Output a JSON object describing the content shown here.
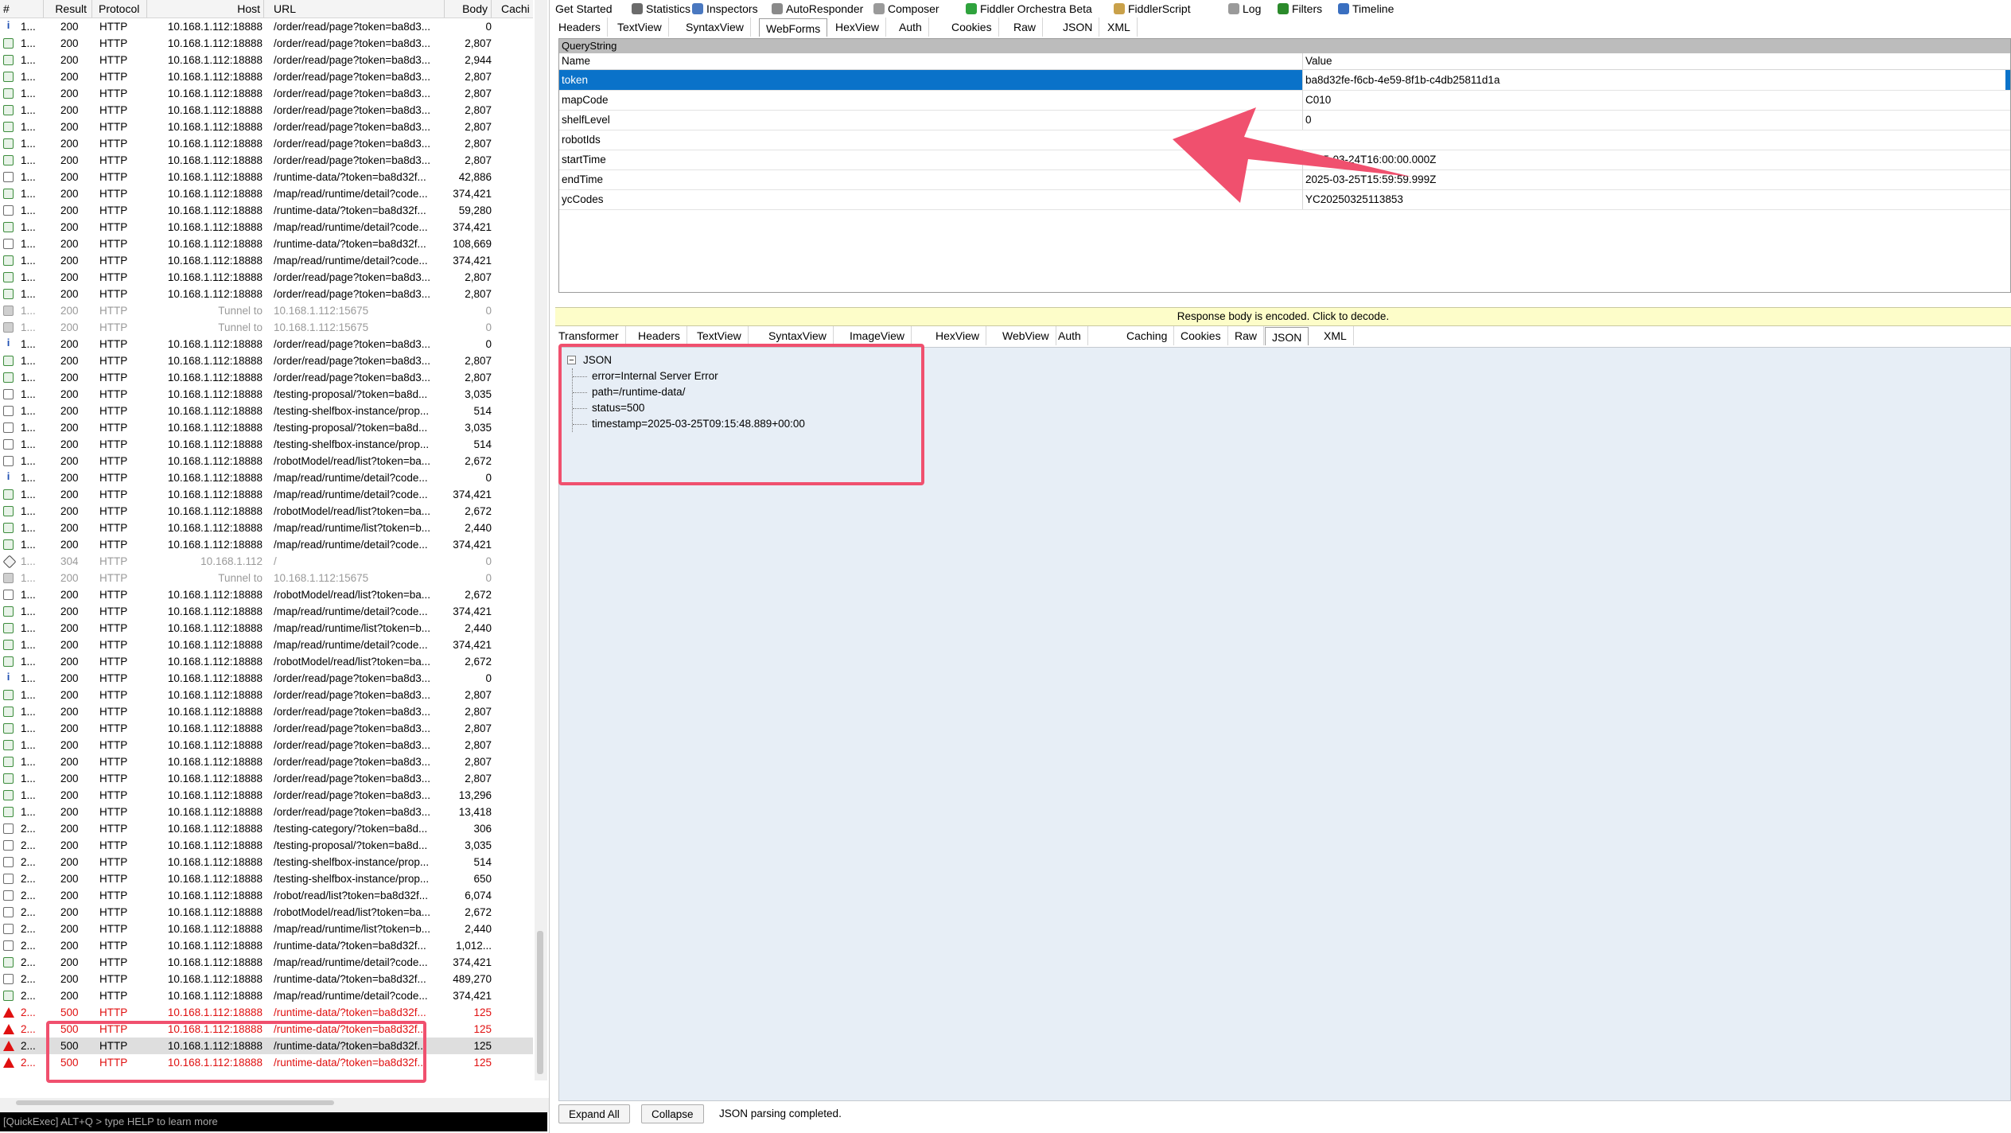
{
  "sessions": {
    "columns": {
      "num": "#",
      "result": "Result",
      "protocol": "Protocol",
      "host": "Host",
      "url": "URL",
      "body": "Body",
      "caching": "Cachi"
    },
    "rows": [
      {
        "icon": "info-icon",
        "num": "1...",
        "result": "200",
        "protocol": "HTTP",
        "host": "10.168.1.112:18888",
        "url": "/order/read/page?token=ba8d3...",
        "body": "0",
        "kind": "normal"
      },
      {
        "icon": "document-icon",
        "num": "1...",
        "result": "200",
        "protocol": "HTTP",
        "host": "10.168.1.112:18888",
        "url": "/order/read/page?token=ba8d3...",
        "body": "2,807",
        "kind": "normal"
      },
      {
        "icon": "document-icon",
        "num": "1...",
        "result": "200",
        "protocol": "HTTP",
        "host": "10.168.1.112:18888",
        "url": "/order/read/page?token=ba8d3...",
        "body": "2,944",
        "kind": "normal"
      },
      {
        "icon": "document-icon",
        "num": "1...",
        "result": "200",
        "protocol": "HTTP",
        "host": "10.168.1.112:18888",
        "url": "/order/read/page?token=ba8d3...",
        "body": "2,807",
        "kind": "normal"
      },
      {
        "icon": "document-icon",
        "num": "1...",
        "result": "200",
        "protocol": "HTTP",
        "host": "10.168.1.112:18888",
        "url": "/order/read/page?token=ba8d3...",
        "body": "2,807",
        "kind": "normal"
      },
      {
        "icon": "document-icon",
        "num": "1...",
        "result": "200",
        "protocol": "HTTP",
        "host": "10.168.1.112:18888",
        "url": "/order/read/page?token=ba8d3...",
        "body": "2,807",
        "kind": "normal"
      },
      {
        "icon": "document-icon",
        "num": "1...",
        "result": "200",
        "protocol": "HTTP",
        "host": "10.168.1.112:18888",
        "url": "/order/read/page?token=ba8d3...",
        "body": "2,807",
        "kind": "normal"
      },
      {
        "icon": "document-icon",
        "num": "1...",
        "result": "200",
        "protocol": "HTTP",
        "host": "10.168.1.112:18888",
        "url": "/order/read/page?token=ba8d3...",
        "body": "2,807",
        "kind": "normal"
      },
      {
        "icon": "document-icon",
        "num": "1...",
        "result": "200",
        "protocol": "HTTP",
        "host": "10.168.1.112:18888",
        "url": "/order/read/page?token=ba8d3...",
        "body": "2,807",
        "kind": "normal"
      },
      {
        "icon": "json-icon",
        "num": "1...",
        "result": "200",
        "protocol": "HTTP",
        "host": "10.168.1.112:18888",
        "url": "/runtime-data/?token=ba8d32f...",
        "body": "42,886",
        "kind": "normal"
      },
      {
        "icon": "document-icon",
        "num": "1...",
        "result": "200",
        "protocol": "HTTP",
        "host": "10.168.1.112:18888",
        "url": "/map/read/runtime/detail?code...",
        "body": "374,421",
        "kind": "normal"
      },
      {
        "icon": "json-icon",
        "num": "1...",
        "result": "200",
        "protocol": "HTTP",
        "host": "10.168.1.112:18888",
        "url": "/runtime-data/?token=ba8d32f...",
        "body": "59,280",
        "kind": "normal"
      },
      {
        "icon": "document-icon",
        "num": "1...",
        "result": "200",
        "protocol": "HTTP",
        "host": "10.168.1.112:18888",
        "url": "/map/read/runtime/detail?code...",
        "body": "374,421",
        "kind": "normal"
      },
      {
        "icon": "json-icon",
        "num": "1...",
        "result": "200",
        "protocol": "HTTP",
        "host": "10.168.1.112:18888",
        "url": "/runtime-data/?token=ba8d32f...",
        "body": "108,669",
        "kind": "normal"
      },
      {
        "icon": "document-icon",
        "num": "1...",
        "result": "200",
        "protocol": "HTTP",
        "host": "10.168.1.112:18888",
        "url": "/map/read/runtime/detail?code...",
        "body": "374,421",
        "kind": "normal"
      },
      {
        "icon": "document-icon",
        "num": "1...",
        "result": "200",
        "protocol": "HTTP",
        "host": "10.168.1.112:18888",
        "url": "/order/read/page?token=ba8d3...",
        "body": "2,807",
        "kind": "normal"
      },
      {
        "icon": "document-icon",
        "num": "1...",
        "result": "200",
        "protocol": "HTTP",
        "host": "10.168.1.112:18888",
        "url": "/order/read/page?token=ba8d3...",
        "body": "2,807",
        "kind": "normal"
      },
      {
        "icon": "lock-icon",
        "num": "1...",
        "result": "200",
        "protocol": "HTTP",
        "host": "Tunnel to",
        "url": "10.168.1.112:15675",
        "body": "0",
        "kind": "tunnel"
      },
      {
        "icon": "lock-icon",
        "num": "1...",
        "result": "200",
        "protocol": "HTTP",
        "host": "Tunnel to",
        "url": "10.168.1.112:15675",
        "body": "0",
        "kind": "tunnel"
      },
      {
        "icon": "info-icon",
        "num": "1...",
        "result": "200",
        "protocol": "HTTP",
        "host": "10.168.1.112:18888",
        "url": "/order/read/page?token=ba8d3...",
        "body": "0",
        "kind": "normal"
      },
      {
        "icon": "document-icon",
        "num": "1...",
        "result": "200",
        "protocol": "HTTP",
        "host": "10.168.1.112:18888",
        "url": "/order/read/page?token=ba8d3...",
        "body": "2,807",
        "kind": "normal"
      },
      {
        "icon": "document-icon",
        "num": "1...",
        "result": "200",
        "protocol": "HTTP",
        "host": "10.168.1.112:18888",
        "url": "/order/read/page?token=ba8d3...",
        "body": "2,807",
        "kind": "normal"
      },
      {
        "icon": "json-icon",
        "num": "1...",
        "result": "200",
        "protocol": "HTTP",
        "host": "10.168.1.112:18888",
        "url": "/testing-proposal/?token=ba8d...",
        "body": "3,035",
        "kind": "normal"
      },
      {
        "icon": "json-icon",
        "num": "1...",
        "result": "200",
        "protocol": "HTTP",
        "host": "10.168.1.112:18888",
        "url": "/testing-shelfbox-instance/prop...",
        "body": "514",
        "kind": "normal"
      },
      {
        "icon": "json-icon",
        "num": "1...",
        "result": "200",
        "protocol": "HTTP",
        "host": "10.168.1.112:18888",
        "url": "/testing-proposal/?token=ba8d...",
        "body": "3,035",
        "kind": "normal"
      },
      {
        "icon": "json-icon",
        "num": "1...",
        "result": "200",
        "protocol": "HTTP",
        "host": "10.168.1.112:18888",
        "url": "/testing-shelfbox-instance/prop...",
        "body": "514",
        "kind": "normal"
      },
      {
        "icon": "json-icon",
        "num": "1...",
        "result": "200",
        "protocol": "HTTP",
        "host": "10.168.1.112:18888",
        "url": "/robotModel/read/list?token=ba...",
        "body": "2,672",
        "kind": "normal"
      },
      {
        "icon": "info-icon",
        "num": "1...",
        "result": "200",
        "protocol": "HTTP",
        "host": "10.168.1.112:18888",
        "url": "/map/read/runtime/detail?code...",
        "body": "0",
        "kind": "normal"
      },
      {
        "icon": "document-icon",
        "num": "1...",
        "result": "200",
        "protocol": "HTTP",
        "host": "10.168.1.112:18888",
        "url": "/map/read/runtime/detail?code...",
        "body": "374,421",
        "kind": "normal"
      },
      {
        "icon": "document-icon",
        "num": "1...",
        "result": "200",
        "protocol": "HTTP",
        "host": "10.168.1.112:18888",
        "url": "/robotModel/read/list?token=ba...",
        "body": "2,672",
        "kind": "normal"
      },
      {
        "icon": "document-icon",
        "num": "1...",
        "result": "200",
        "protocol": "HTTP",
        "host": "10.168.1.112:18888",
        "url": "/map/read/runtime/list?token=b...",
        "body": "2,440",
        "kind": "normal"
      },
      {
        "icon": "document-icon",
        "num": "1...",
        "result": "200",
        "protocol": "HTTP",
        "host": "10.168.1.112:18888",
        "url": "/map/read/runtime/detail?code...",
        "body": "374,421",
        "kind": "normal"
      },
      {
        "icon": "diamond-icon",
        "num": "1...",
        "result": "304",
        "protocol": "HTTP",
        "host": "10.168.1.112",
        "url": "/",
        "body": "0",
        "kind": "tunnel"
      },
      {
        "icon": "lock-icon",
        "num": "1...",
        "result": "200",
        "protocol": "HTTP",
        "host": "Tunnel to",
        "url": "10.168.1.112:15675",
        "body": "0",
        "kind": "tunnel"
      },
      {
        "icon": "json-icon",
        "num": "1...",
        "result": "200",
        "protocol": "HTTP",
        "host": "10.168.1.112:18888",
        "url": "/robotModel/read/list?token=ba...",
        "body": "2,672",
        "kind": "normal"
      },
      {
        "icon": "document-icon",
        "num": "1...",
        "result": "200",
        "protocol": "HTTP",
        "host": "10.168.1.112:18888",
        "url": "/map/read/runtime/detail?code...",
        "body": "374,421",
        "kind": "normal"
      },
      {
        "icon": "document-icon",
        "num": "1...",
        "result": "200",
        "protocol": "HTTP",
        "host": "10.168.1.112:18888",
        "url": "/map/read/runtime/list?token=b...",
        "body": "2,440",
        "kind": "normal"
      },
      {
        "icon": "document-icon",
        "num": "1...",
        "result": "200",
        "protocol": "HTTP",
        "host": "10.168.1.112:18888",
        "url": "/map/read/runtime/detail?code...",
        "body": "374,421",
        "kind": "normal"
      },
      {
        "icon": "document-icon",
        "num": "1...",
        "result": "200",
        "protocol": "HTTP",
        "host": "10.168.1.112:18888",
        "url": "/robotModel/read/list?token=ba...",
        "body": "2,672",
        "kind": "normal"
      },
      {
        "icon": "info-icon",
        "num": "1...",
        "result": "200",
        "protocol": "HTTP",
        "host": "10.168.1.112:18888",
        "url": "/order/read/page?token=ba8d3...",
        "body": "0",
        "kind": "normal"
      },
      {
        "icon": "document-icon",
        "num": "1...",
        "result": "200",
        "protocol": "HTTP",
        "host": "10.168.1.112:18888",
        "url": "/order/read/page?token=ba8d3...",
        "body": "2,807",
        "kind": "normal"
      },
      {
        "icon": "document-icon",
        "num": "1...",
        "result": "200",
        "protocol": "HTTP",
        "host": "10.168.1.112:18888",
        "url": "/order/read/page?token=ba8d3...",
        "body": "2,807",
        "kind": "normal"
      },
      {
        "icon": "document-icon",
        "num": "1...",
        "result": "200",
        "protocol": "HTTP",
        "host": "10.168.1.112:18888",
        "url": "/order/read/page?token=ba8d3...",
        "body": "2,807",
        "kind": "normal"
      },
      {
        "icon": "document-icon",
        "num": "1...",
        "result": "200",
        "protocol": "HTTP",
        "host": "10.168.1.112:18888",
        "url": "/order/read/page?token=ba8d3...",
        "body": "2,807",
        "kind": "normal"
      },
      {
        "icon": "document-icon",
        "num": "1...",
        "result": "200",
        "protocol": "HTTP",
        "host": "10.168.1.112:18888",
        "url": "/order/read/page?token=ba8d3...",
        "body": "2,807",
        "kind": "normal"
      },
      {
        "icon": "document-icon",
        "num": "1...",
        "result": "200",
        "protocol": "HTTP",
        "host": "10.168.1.112:18888",
        "url": "/order/read/page?token=ba8d3...",
        "body": "2,807",
        "kind": "normal"
      },
      {
        "icon": "document-icon",
        "num": "1...",
        "result": "200",
        "protocol": "HTTP",
        "host": "10.168.1.112:18888",
        "url": "/order/read/page?token=ba8d3...",
        "body": "13,296",
        "kind": "normal"
      },
      {
        "icon": "document-icon",
        "num": "1...",
        "result": "200",
        "protocol": "HTTP",
        "host": "10.168.1.112:18888",
        "url": "/order/read/page?token=ba8d3...",
        "body": "13,418",
        "kind": "normal"
      },
      {
        "icon": "json-icon",
        "num": "2...",
        "result": "200",
        "protocol": "HTTP",
        "host": "10.168.1.112:18888",
        "url": "/testing-category/?token=ba8d...",
        "body": "306",
        "kind": "normal"
      },
      {
        "icon": "json-icon",
        "num": "2...",
        "result": "200",
        "protocol": "HTTP",
        "host": "10.168.1.112:18888",
        "url": "/testing-proposal/?token=ba8d...",
        "body": "3,035",
        "kind": "normal"
      },
      {
        "icon": "json-icon",
        "num": "2...",
        "result": "200",
        "protocol": "HTTP",
        "host": "10.168.1.112:18888",
        "url": "/testing-shelfbox-instance/prop...",
        "body": "514",
        "kind": "normal"
      },
      {
        "icon": "json-icon",
        "num": "2...",
        "result": "200",
        "protocol": "HTTP",
        "host": "10.168.1.112:18888",
        "url": "/testing-shelfbox-instance/prop...",
        "body": "650",
        "kind": "normal"
      },
      {
        "icon": "json-icon",
        "num": "2...",
        "result": "200",
        "protocol": "HTTP",
        "host": "10.168.1.112:18888",
        "url": "/robot/read/list?token=ba8d32f...",
        "body": "6,074",
        "kind": "normal"
      },
      {
        "icon": "json-icon",
        "num": "2...",
        "result": "200",
        "protocol": "HTTP",
        "host": "10.168.1.112:18888",
        "url": "/robotModel/read/list?token=ba...",
        "body": "2,672",
        "kind": "normal"
      },
      {
        "icon": "json-icon",
        "num": "2...",
        "result": "200",
        "protocol": "HTTP",
        "host": "10.168.1.112:18888",
        "url": "/map/read/runtime/list?token=b...",
        "body": "2,440",
        "kind": "normal"
      },
      {
        "icon": "json-icon",
        "num": "2...",
        "result": "200",
        "protocol": "HTTP",
        "host": "10.168.1.112:18888",
        "url": "/runtime-data/?token=ba8d32f...",
        "body": "1,012...",
        "kind": "normal"
      },
      {
        "icon": "document-icon",
        "num": "2...",
        "result": "200",
        "protocol": "HTTP",
        "host": "10.168.1.112:18888",
        "url": "/map/read/runtime/detail?code...",
        "body": "374,421",
        "kind": "normal"
      },
      {
        "icon": "json-icon",
        "num": "2...",
        "result": "200",
        "protocol": "HTTP",
        "host": "10.168.1.112:18888",
        "url": "/runtime-data/?token=ba8d32f...",
        "body": "489,270",
        "kind": "normal"
      },
      {
        "icon": "document-icon",
        "num": "2...",
        "result": "200",
        "protocol": "HTTP",
        "host": "10.168.1.112:18888",
        "url": "/map/read/runtime/detail?code...",
        "body": "374,421",
        "kind": "normal"
      },
      {
        "icon": "warning-icon",
        "num": "2...",
        "result": "500",
        "protocol": "HTTP",
        "host": "10.168.1.112:18888",
        "url": "/runtime-data/?token=ba8d32f...",
        "body": "125",
        "kind": "err"
      },
      {
        "icon": "warning-icon",
        "num": "2...",
        "result": "500",
        "protocol": "HTTP",
        "host": "10.168.1.112:18888",
        "url": "/runtime-data/?token=ba8d32f...",
        "body": "125",
        "kind": "err"
      },
      {
        "icon": "warning-icon",
        "num": "2...",
        "result": "500",
        "protocol": "HTTP",
        "host": "10.168.1.112:18888",
        "url": "/runtime-data/?token=ba8d32f...",
        "body": "125",
        "kind": "sel"
      },
      {
        "icon": "warning-icon",
        "num": "2...",
        "result": "500",
        "protocol": "HTTP",
        "host": "10.168.1.112:18888",
        "url": "/runtime-data/?token=ba8d32f...",
        "body": "125",
        "kind": "err"
      }
    ],
    "quickexec": "[QuickExec] ALT+Q > type HELP to learn more"
  },
  "main_tabs": [
    {
      "label": "Get Started",
      "icon": "",
      "color": ""
    },
    {
      "label": "Statistics",
      "icon": "stopwatch-icon",
      "color": "#6b6b6b"
    },
    {
      "label": "Inspectors",
      "icon": "inspector-icon",
      "color": "#4a78c0"
    },
    {
      "label": "AutoResponder",
      "icon": "lightning-icon",
      "color": "#8a8a8a"
    },
    {
      "label": "Composer",
      "icon": "pencil-icon",
      "color": "#9a9a9a"
    },
    {
      "label": "Fiddler Orchestra Beta",
      "icon": "fo-icon",
      "color": "#2fa33d"
    },
    {
      "label": "FiddlerScript",
      "icon": "script-icon",
      "color": "#c9a14a"
    },
    {
      "label": "Log",
      "icon": "log-icon",
      "color": "#9a9a9a"
    },
    {
      "label": "Filters",
      "icon": "checkbox-icon",
      "color": "#2b8a2b"
    },
    {
      "label": "Timeline",
      "icon": "timeline-icon",
      "color": "#3a6fc0"
    }
  ],
  "request_tabs": [
    "Headers",
    "TextView",
    "SyntaxView",
    "WebForms",
    "HexView",
    "Auth",
    "Cookies",
    "Raw",
    "JSON",
    "XML"
  ],
  "request_active": "WebForms",
  "querystring": {
    "title": "QueryString",
    "col_name": "Name",
    "col_value": "Value",
    "rows": [
      {
        "name": "token",
        "value": "ba8d32fe-f6cb-4e59-8f1b-c4db25811d1a"
      },
      {
        "name": "mapCode",
        "value": "C010"
      },
      {
        "name": "shelfLevel",
        "value": "0"
      },
      {
        "name": "robotIds",
        "value": ""
      },
      {
        "name": "startTime",
        "value": "2025-03-24T16:00:00.000Z"
      },
      {
        "name": "endTime",
        "value": "2025-03-25T15:59:59.999Z"
      },
      {
        "name": "ycCodes",
        "value": "YC20250325113853"
      }
    ]
  },
  "encoded_notice": "Response body is encoded. Click to decode.",
  "response_tabs": [
    "Transformer",
    "Headers",
    "TextView",
    "SyntaxView",
    "ImageView",
    "HexView",
    "WebView",
    "Auth",
    "Caching",
    "Cookies",
    "Raw",
    "JSON",
    "XML"
  ],
  "response_active": "JSON",
  "json_tree": {
    "root": "JSON",
    "children": [
      "error=Internal Server Error",
      "path=/runtime-data/",
      "status=500",
      "timestamp=2025-03-25T09:15:48.889+00:00"
    ]
  },
  "footer": {
    "expand_all": "Expand All",
    "collapse": "Collapse",
    "status": "JSON parsing completed."
  },
  "colors": {
    "selection": "#0a72c9",
    "highlight": "#f0506e",
    "error": "#e01010",
    "notice_bg": "#fdfdc9",
    "json_bg": "#e7eef6"
  }
}
